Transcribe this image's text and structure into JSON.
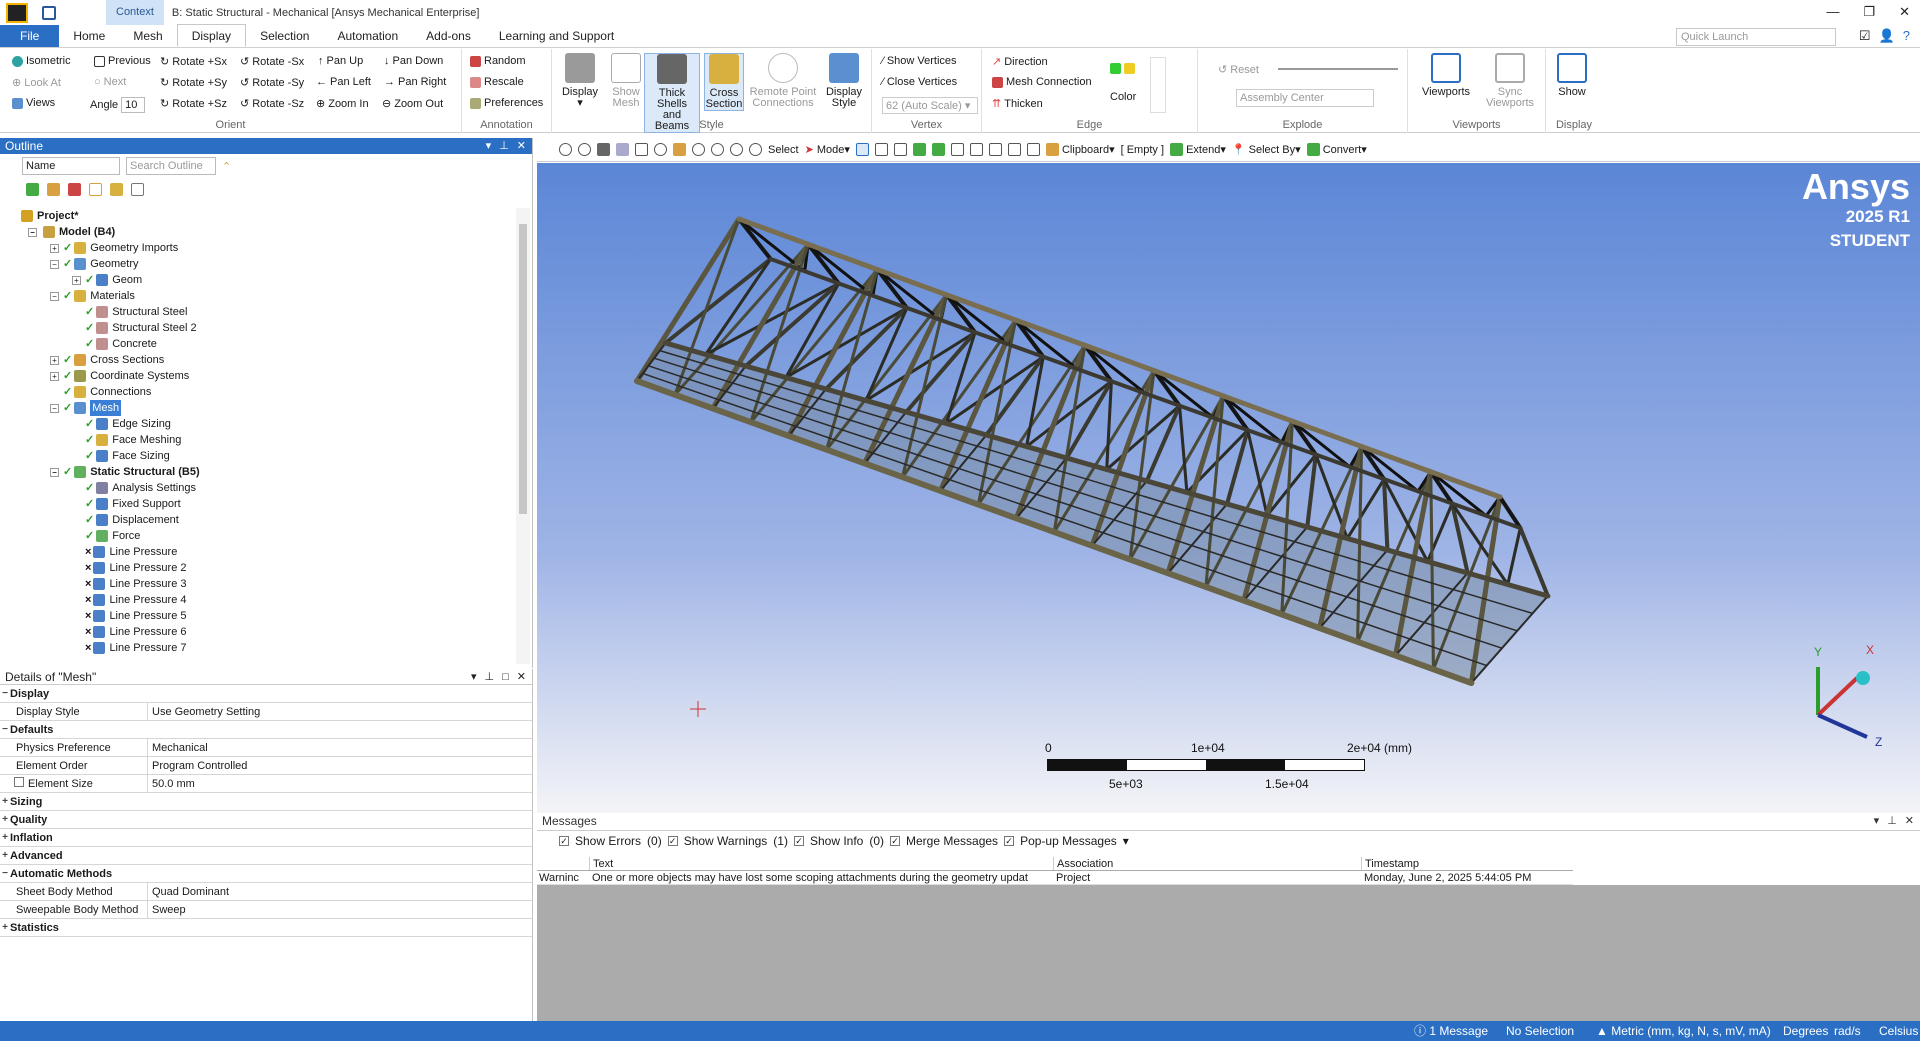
{
  "title_bar": {
    "context_label": "Context",
    "title": "B: Static Structural - Mechanical [Ansys Mechanical Enterprise]",
    "minimize": "—",
    "restore": "❐",
    "close": "✕"
  },
  "menu_tabs": [
    "File",
    "Home",
    "Mesh",
    "Display",
    "Selection",
    "Automation",
    "Add-ons",
    "Learning and Support"
  ],
  "active_tab": "Display",
  "quick_launch": {
    "placeholder": "Quick Launch"
  },
  "ribbon": {
    "orient": {
      "label": "Orient",
      "items": {
        "isometric": "Isometric",
        "previous": "Previous",
        "rotate_px": "Rotate +Sx",
        "rotate_mx": "Rotate -Sx",
        "pan_up": "Pan Up",
        "pan_down": "Pan Down",
        "look_at": "Look At",
        "next": "Next",
        "rotate_py": "Rotate +Sy",
        "rotate_my": "Rotate -Sy",
        "pan_left": "Pan Left",
        "pan_right": "Pan Right",
        "views": "Views",
        "angle": "Angle",
        "angle_value": "10",
        "rotate_pz": "Rotate +Sz",
        "rotate_mz": "Rotate -Sz",
        "zoom_in": "Zoom In",
        "zoom_out": "Zoom Out"
      }
    },
    "annotation": {
      "label": "Annotation",
      "items": {
        "random": "Random",
        "rescale": "Rescale",
        "preferences": "Preferences"
      }
    },
    "style": {
      "label": "Style",
      "items": {
        "display": "Display",
        "show_mesh_1": "Show",
        "show_mesh_2": "Mesh",
        "thick_1": "Thick Shells",
        "thick_2": "and Beams",
        "cross_1": "Cross",
        "cross_2": "Section",
        "remote_1": "Remote Point",
        "remote_2": "Connections",
        "dstyle_1": "Display",
        "dstyle_2": "Style"
      }
    },
    "vertex": {
      "label": "Vertex",
      "items": {
        "show_vertices": "Show Vertices",
        "close_vertices": "Close Vertices",
        "auto_scale": "62 (Auto Scale)"
      }
    },
    "edge": {
      "label": "Edge",
      "items": {
        "direction": "Direction",
        "mesh_connection": "Mesh Connection",
        "thicken": "Thicken",
        "color": "Color"
      }
    },
    "explode": {
      "label": "Explode",
      "items": {
        "reset": "Reset",
        "assembly_center": "Assembly Center"
      }
    },
    "viewports": {
      "label": "Viewports",
      "items": {
        "viewports": "Viewports",
        "sync_1": "Sync",
        "sync_2": "Viewports"
      }
    },
    "display": {
      "label": "Display",
      "items": {
        "show": "Show"
      }
    }
  },
  "outline": {
    "header": "Outline",
    "filter_name": "Name",
    "search_placeholder": "Search Outline",
    "tree": [
      {
        "label": "Project*",
        "level": 0,
        "bold": true,
        "exp": "",
        "status": "",
        "icon": "#d4a020"
      },
      {
        "label": "Model (B4)",
        "level": 1,
        "bold": true,
        "exp": "−",
        "status": "",
        "icon": "#c8a040"
      },
      {
        "label": "Geometry Imports",
        "level": 2,
        "exp": "+",
        "status": "check",
        "icon": "#d8b040"
      },
      {
        "label": "Geometry",
        "level": 2,
        "exp": "−",
        "status": "check",
        "icon": "#5a8fd0"
      },
      {
        "label": "Geom",
        "level": 3,
        "exp": "+",
        "status": "check",
        "icon": "#4a80c8"
      },
      {
        "label": "Materials",
        "level": 2,
        "exp": "−",
        "status": "check",
        "icon": "#d8b040"
      },
      {
        "label": "Structural Steel",
        "level": 3,
        "status": "check",
        "icon": "#c09090"
      },
      {
        "label": "Structural Steel 2",
        "level": 3,
        "status": "check",
        "icon": "#c09090"
      },
      {
        "label": "Concrete",
        "level": 3,
        "status": "check",
        "icon": "#c09090"
      },
      {
        "label": "Cross Sections",
        "level": 2,
        "exp": "+",
        "status": "check",
        "icon": "#d8a040"
      },
      {
        "label": "Coordinate Systems",
        "level": 2,
        "exp": "+",
        "status": "check",
        "icon": "#9a9a4a"
      },
      {
        "label": "Connections",
        "level": 2,
        "status": "check",
        "icon": "#d8b040"
      },
      {
        "label": "Mesh",
        "level": 2,
        "exp": "−",
        "status": "check",
        "icon": "#5a8fd0",
        "highlight": true
      },
      {
        "label": "Edge Sizing",
        "level": 3,
        "status": "check",
        "icon": "#4a80c8"
      },
      {
        "label": "Face Meshing",
        "level": 3,
        "status": "check",
        "icon": "#d8b040"
      },
      {
        "label": "Face Sizing",
        "level": 3,
        "status": "check",
        "icon": "#4a80c8"
      },
      {
        "label": "Static Structural (B5)",
        "level": 2,
        "exp": "−",
        "status": "check",
        "icon": "#60b060",
        "bold": true
      },
      {
        "label": "Analysis Settings",
        "level": 3,
        "status": "check",
        "icon": "#8080a0"
      },
      {
        "label": "Fixed Support",
        "level": 3,
        "status": "check",
        "icon": "#4a80c8"
      },
      {
        "label": "Displacement",
        "level": 3,
        "status": "check",
        "icon": "#4a80c8"
      },
      {
        "label": "Force",
        "level": 3,
        "status": "check",
        "icon": "#60b060"
      },
      {
        "label": "Line Pressure",
        "level": 3,
        "status": "x",
        "icon": "#4a80c8"
      },
      {
        "label": "Line Pressure 2",
        "level": 3,
        "status": "x",
        "icon": "#4a80c8"
      },
      {
        "label": "Line Pressure 3",
        "level": 3,
        "status": "x",
        "icon": "#4a80c8"
      },
      {
        "label": "Line Pressure 4",
        "level": 3,
        "status": "x",
        "icon": "#4a80c8"
      },
      {
        "label": "Line Pressure 5",
        "level": 3,
        "status": "x",
        "icon": "#4a80c8"
      },
      {
        "label": "Line Pressure 6",
        "level": 3,
        "status": "x",
        "icon": "#4a80c8"
      },
      {
        "label": "Line Pressure 7",
        "level": 3,
        "status": "x",
        "icon": "#4a80c8"
      }
    ]
  },
  "details": {
    "header": "Details of \"Mesh\"",
    "rows": [
      {
        "type": "cat",
        "toggle": "−",
        "label": "Display"
      },
      {
        "type": "prop",
        "key": "Display Style",
        "value": "Use Geometry Setting"
      },
      {
        "type": "cat",
        "toggle": "−",
        "label": "Defaults"
      },
      {
        "type": "prop",
        "key": "Physics Preference",
        "value": "Mechanical"
      },
      {
        "type": "prop",
        "key": "Element Order",
        "value": "Program Controlled"
      },
      {
        "type": "prop",
        "key": "Element Size",
        "value": "50.0 mm",
        "checkbox": true
      },
      {
        "type": "cat",
        "toggle": "+",
        "label": "Sizing"
      },
      {
        "type": "cat",
        "toggle": "+",
        "label": "Quality"
      },
      {
        "type": "cat",
        "toggle": "+",
        "label": "Inflation"
      },
      {
        "type": "cat",
        "toggle": "+",
        "label": "Advanced"
      },
      {
        "type": "cat",
        "toggle": "−",
        "label": "Automatic Methods"
      },
      {
        "type": "prop",
        "key": "Sheet Body Method",
        "value": "Quad Dominant"
      },
      {
        "type": "prop",
        "key": "Sweepable Body Method",
        "value": "Sweep"
      },
      {
        "type": "cat",
        "toggle": "+",
        "label": "Statistics"
      }
    ]
  },
  "view_toolbar": {
    "select": "Select",
    "mode": "Mode",
    "clipboard": "Clipboard",
    "empty": "[ Empty ]",
    "extend": "Extend",
    "select_by": "Select By",
    "convert": "Convert"
  },
  "viewport": {
    "brand": "Ansys",
    "version": "2025 R1",
    "edition": "STUDENT",
    "scale_labels": {
      "t0": "0",
      "t1": "1e+04",
      "t2": "2e+04 (mm)",
      "b1": "5e+03",
      "b2": "1.5e+04"
    },
    "axes": {
      "x": "X",
      "y": "Y",
      "z": "Z"
    }
  },
  "messages": {
    "header": "Messages",
    "show_errors": "Show Errors",
    "errors_count": "(0)",
    "show_warnings": "Show Warnings",
    "warnings_count": "(1)",
    "show_info": "Show Info",
    "info_count": "(0)",
    "merge": "Merge Messages",
    "popup": "Pop-up Messages",
    "columns": {
      "text": "Text",
      "association": "Association",
      "timestamp": "Timestamp"
    },
    "rows": [
      {
        "type": "Warninc",
        "text": "One or more objects may have lost some scoping attachments during the geometry updat",
        "association": "Project",
        "timestamp": "Monday, June 2, 2025 5:44:05 PM"
      }
    ]
  },
  "status_bar": {
    "messages": "1 Message",
    "selection": "No Selection",
    "units": "Metric (mm, kg, N, s, mV, mA)",
    "angle": "Degrees",
    "rate": "rad/s",
    "temp": "Celsius"
  }
}
